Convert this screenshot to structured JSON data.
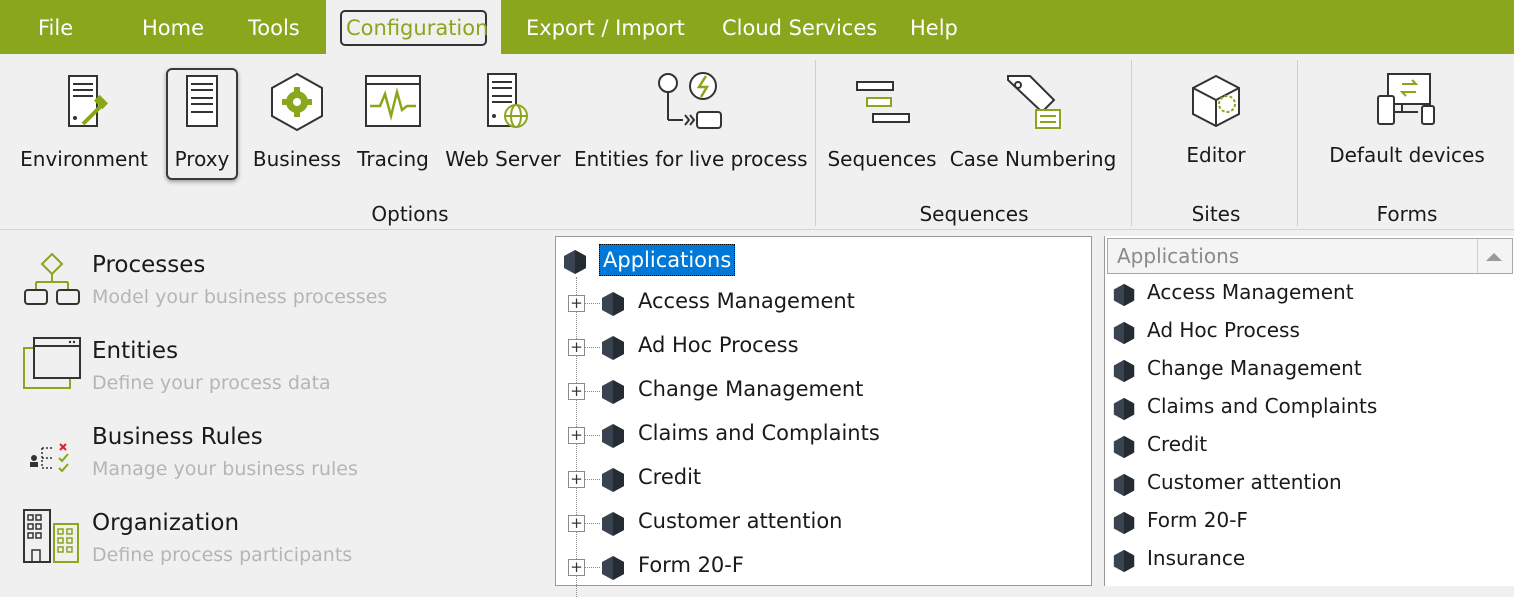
{
  "menu": {
    "items": [
      {
        "label": "File"
      },
      {
        "label": "Home"
      },
      {
        "label": "Tools"
      },
      {
        "label": "Configuration",
        "active": true
      },
      {
        "label": "Export / Import"
      },
      {
        "label": "Cloud Services"
      },
      {
        "label": "Help"
      }
    ]
  },
  "ribbon": {
    "options": {
      "group_label": "Options",
      "buttons": [
        {
          "label": "Environment",
          "icon": "server-hammer-icon"
        },
        {
          "label": "Proxy",
          "icon": "proxy-server-icon",
          "selected": true
        },
        {
          "label": "Business",
          "icon": "gear-hexagon-icon"
        },
        {
          "label": "Tracing",
          "icon": "tracing-wave-icon"
        },
        {
          "label": "Web Server",
          "icon": "web-server-icon"
        },
        {
          "label": "Entities for live process",
          "icon": "entities-live-process-icon"
        }
      ]
    },
    "sequences": {
      "group_label": "Sequences",
      "buttons": [
        {
          "label": "Sequences",
          "icon": "sequences-icon"
        },
        {
          "label": "Case Numbering",
          "icon": "case-numbering-tag-icon"
        }
      ]
    },
    "sites": {
      "group_label": "Sites",
      "buttons": [
        {
          "label": "Editor",
          "icon": "editor-cube-icon"
        }
      ]
    },
    "forms": {
      "group_label": "Forms",
      "buttons": [
        {
          "label": "Default devices",
          "icon": "devices-icon"
        }
      ]
    }
  },
  "left_nav": [
    {
      "title": "Processes",
      "subtitle": "Model your business processes",
      "icon": "processes-icon"
    },
    {
      "title": "Entities",
      "subtitle": "Define your process data",
      "icon": "entities-icon"
    },
    {
      "title": "Business Rules",
      "subtitle": "Manage your business rules",
      "icon": "business-rules-icon"
    },
    {
      "title": "Organization",
      "subtitle": "Define process participants",
      "icon": "organization-icon"
    }
  ],
  "tree": {
    "root_label": "Applications",
    "items": [
      "Access Management",
      "Ad Hoc Process",
      "Change Management",
      "Claims and Complaints",
      "Credit",
      "Customer attention",
      "Form 20-F"
    ]
  },
  "list": {
    "header": "Applications",
    "items": [
      "Access Management",
      "Ad Hoc Process",
      "Change Management",
      "Claims and Complaints",
      "Credit",
      "Customer attention",
      "Form 20-F",
      "Insurance"
    ]
  },
  "colors": {
    "accent": "#8aa61c",
    "selection": "#0078d7",
    "hex_icon": "#3a4350"
  }
}
